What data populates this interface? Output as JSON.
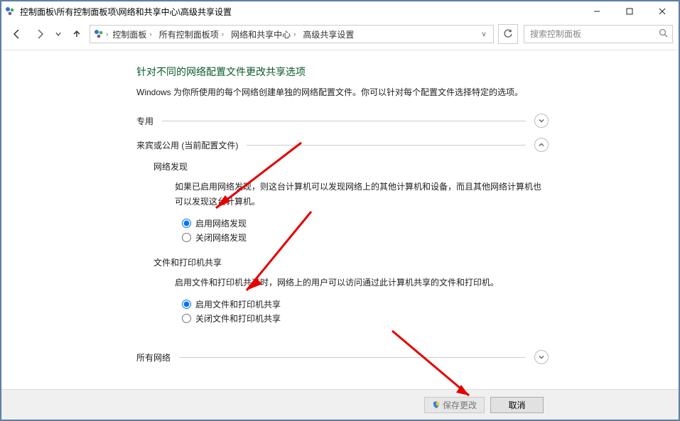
{
  "window": {
    "title": "控制面板\\所有控制面板项\\网络和共享中心\\高级共享设置"
  },
  "breadcrumbs": {
    "root": "控制面板",
    "p1": "所有控制面板项",
    "p2": "网络和共享中心",
    "p3": "高级共享设置"
  },
  "search": {
    "placeholder": "搜索控制面板"
  },
  "heading": "针对不同的网络配置文件更改共享选项",
  "subtext": "Windows 为你所使用的每个网络创建单独的网络配置文件。你可以针对每个配置文件选择特定的选项。",
  "sections": {
    "private": {
      "title": "专用"
    },
    "guest": {
      "title": "来宾或公用 (当前配置文件)",
      "net_discovery": {
        "title": "网络发现",
        "desc": "如果已启用网络发现，则这台计算机可以发现网络上的其他计算机和设备，而且其他网络计算机也可以发现这台计算机。",
        "opt_on": "启用网络发现",
        "opt_off": "关闭网络发现"
      },
      "file_printer": {
        "title": "文件和打印机共享",
        "desc": "启用文件和打印机共享时，网络上的用户可以访问通过此计算机共享的文件和打印机。",
        "opt_on": "启用文件和打印机共享",
        "opt_off": "关闭文件和打印机共享"
      }
    },
    "all": {
      "title": "所有网络"
    }
  },
  "buttons": {
    "save": "保存更改",
    "cancel": "取消"
  }
}
